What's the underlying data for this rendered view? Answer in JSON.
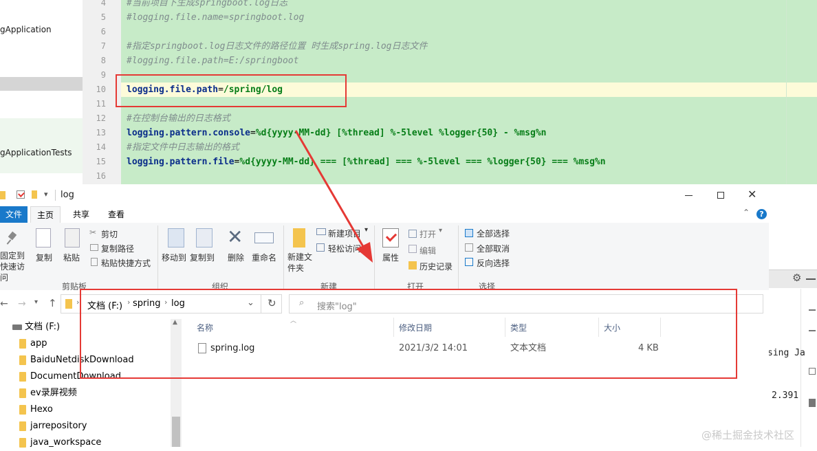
{
  "ide": {
    "project_items": [
      {
        "label": "gApplication"
      },
      {
        "label": "gApplicationTests"
      }
    ],
    "line_numbers": [
      "4",
      "5",
      "6",
      "7",
      "8",
      "9",
      "10",
      "11",
      "12",
      "13",
      "14",
      "15",
      "16"
    ],
    "lines": {
      "l4": "#当前项目下生成springboot.log日志",
      "l5": "#logging.file.name=springboot.log",
      "l7": "#指定springboot.log日志文件的路径位置 时生成spring.log日志文件",
      "l8": "#logging.file.path=E:/springboot",
      "l10_key": "logging.file.path",
      "l10_eq": "=",
      "l10_val": "/spring/log",
      "l12": "#在控制台输出的日志格式",
      "l13_key": "logging.pattern.console",
      "l13_eq": "=",
      "l13_val": "%d{yyyy-MM-dd} [%thread] %-5level %logger{50} - %msg%n",
      "l14": "#指定文件中日志输出的格式",
      "l15_key": "logging.pattern.file",
      "l15_eq": "=",
      "l15_val": "%d{yyyy-MM-dd} === [%thread] === %-5level === %logger{50} === %msg%n"
    }
  },
  "explorer": {
    "title": "log",
    "tabs": [
      "文件",
      "主页",
      "共享",
      "查看"
    ],
    "ribbon": {
      "pin": "固定到快速访问",
      "copy": "复制",
      "paste": "粘贴",
      "cut": "剪切",
      "copy_path": "复制路径",
      "paste_shortcut": "粘贴快捷方式",
      "group_clipboard": "剪贴板",
      "move_to": "移动到",
      "copy_to": "复制到",
      "delete": "删除",
      "rename": "重命名",
      "group_organize": "组织",
      "new_item": "新建项目",
      "easy_access": "轻松访问",
      "new_folder": "新建文件夹",
      "group_new": "新建",
      "properties": "属性",
      "open": "打开",
      "edit": "编辑",
      "history": "历史记录",
      "group_open": "打开",
      "select_all": "全部选择",
      "select_none": "全部取消",
      "invert": "反向选择",
      "group_select": "选择"
    },
    "address": {
      "drive": "文档 (F:)",
      "p1": "spring",
      "p2": "log"
    },
    "search_placeholder": "搜索\"log\"",
    "nav": [
      "文档 (F:)",
      "app",
      "BaiduNetdiskDownload",
      "DocumentDownload",
      "ev录屏视频",
      "Hexo",
      "jarrepository",
      "java_workspace"
    ],
    "columns": {
      "name": "名称",
      "date": "修改日期",
      "type": "类型",
      "size": "大小"
    },
    "file": {
      "name": "spring.log",
      "date": "2021/3/2 14:01",
      "type": "文本文档",
      "size": "4 KB"
    }
  },
  "right_panel": {
    "text1": "sing Ja",
    "text2": "2.391"
  },
  "watermark": "@稀土掘金技术社区",
  "colors": {
    "annotation": "#e53935",
    "code_bg": "#c7ebc8",
    "current_line": "#fdfbd9"
  }
}
